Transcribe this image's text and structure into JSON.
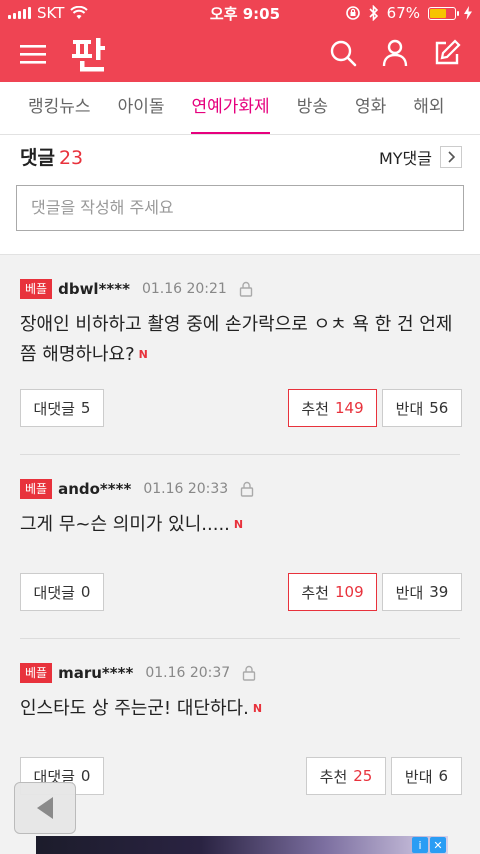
{
  "status": {
    "carrier": "SKT",
    "time": "오후 9:05",
    "battery": "67%",
    "battery_level": 0.67
  },
  "tabs": [
    {
      "label": "랭킹뉴스",
      "active": false
    },
    {
      "label": "아이돌",
      "active": false
    },
    {
      "label": "연예가화제",
      "active": true
    },
    {
      "label": "방송",
      "active": false
    },
    {
      "label": "영화",
      "active": false
    },
    {
      "label": "해외",
      "active": false
    }
  ],
  "comments_header": {
    "title": "댓글",
    "count": "23",
    "my_comments_label": "MY댓글",
    "input_placeholder": "댓글을 작성해 주세요"
  },
  "comments": [
    {
      "badge": "베플",
      "user": "dbwl****",
      "time": "01.16 20:21",
      "text": "장애인 비하하고 촬영 중에 손가락으로 ㅇㅊ 욕 한 건 언제쯤 해명하나요?",
      "new_mark": "N",
      "reply_label": "대댓글",
      "reply_count": "5",
      "up_label": "추천",
      "up_count": "149",
      "down_label": "반대",
      "down_count": "56"
    },
    {
      "badge": "베플",
      "user": "ando****",
      "time": "01.16 20:33",
      "text": "그게 무~슨 의미가 있니.....",
      "new_mark": "N",
      "reply_label": "대댓글",
      "reply_count": "0",
      "up_label": "추천",
      "up_count": "109",
      "down_label": "반대",
      "down_count": "39"
    },
    {
      "badge": "베플",
      "user": "maru****",
      "time": "01.16 20:37",
      "text": "인스타도 상 주는군! 대단하다.",
      "new_mark": "N",
      "reply_label": "대댓글",
      "reply_count": "0",
      "up_label": "추천",
      "up_count": "25",
      "down_label": "반대",
      "down_count": "6"
    }
  ],
  "colors": {
    "brand": "#ef4453",
    "accent_tab": "#e6007e",
    "badge": "#e8323c"
  }
}
